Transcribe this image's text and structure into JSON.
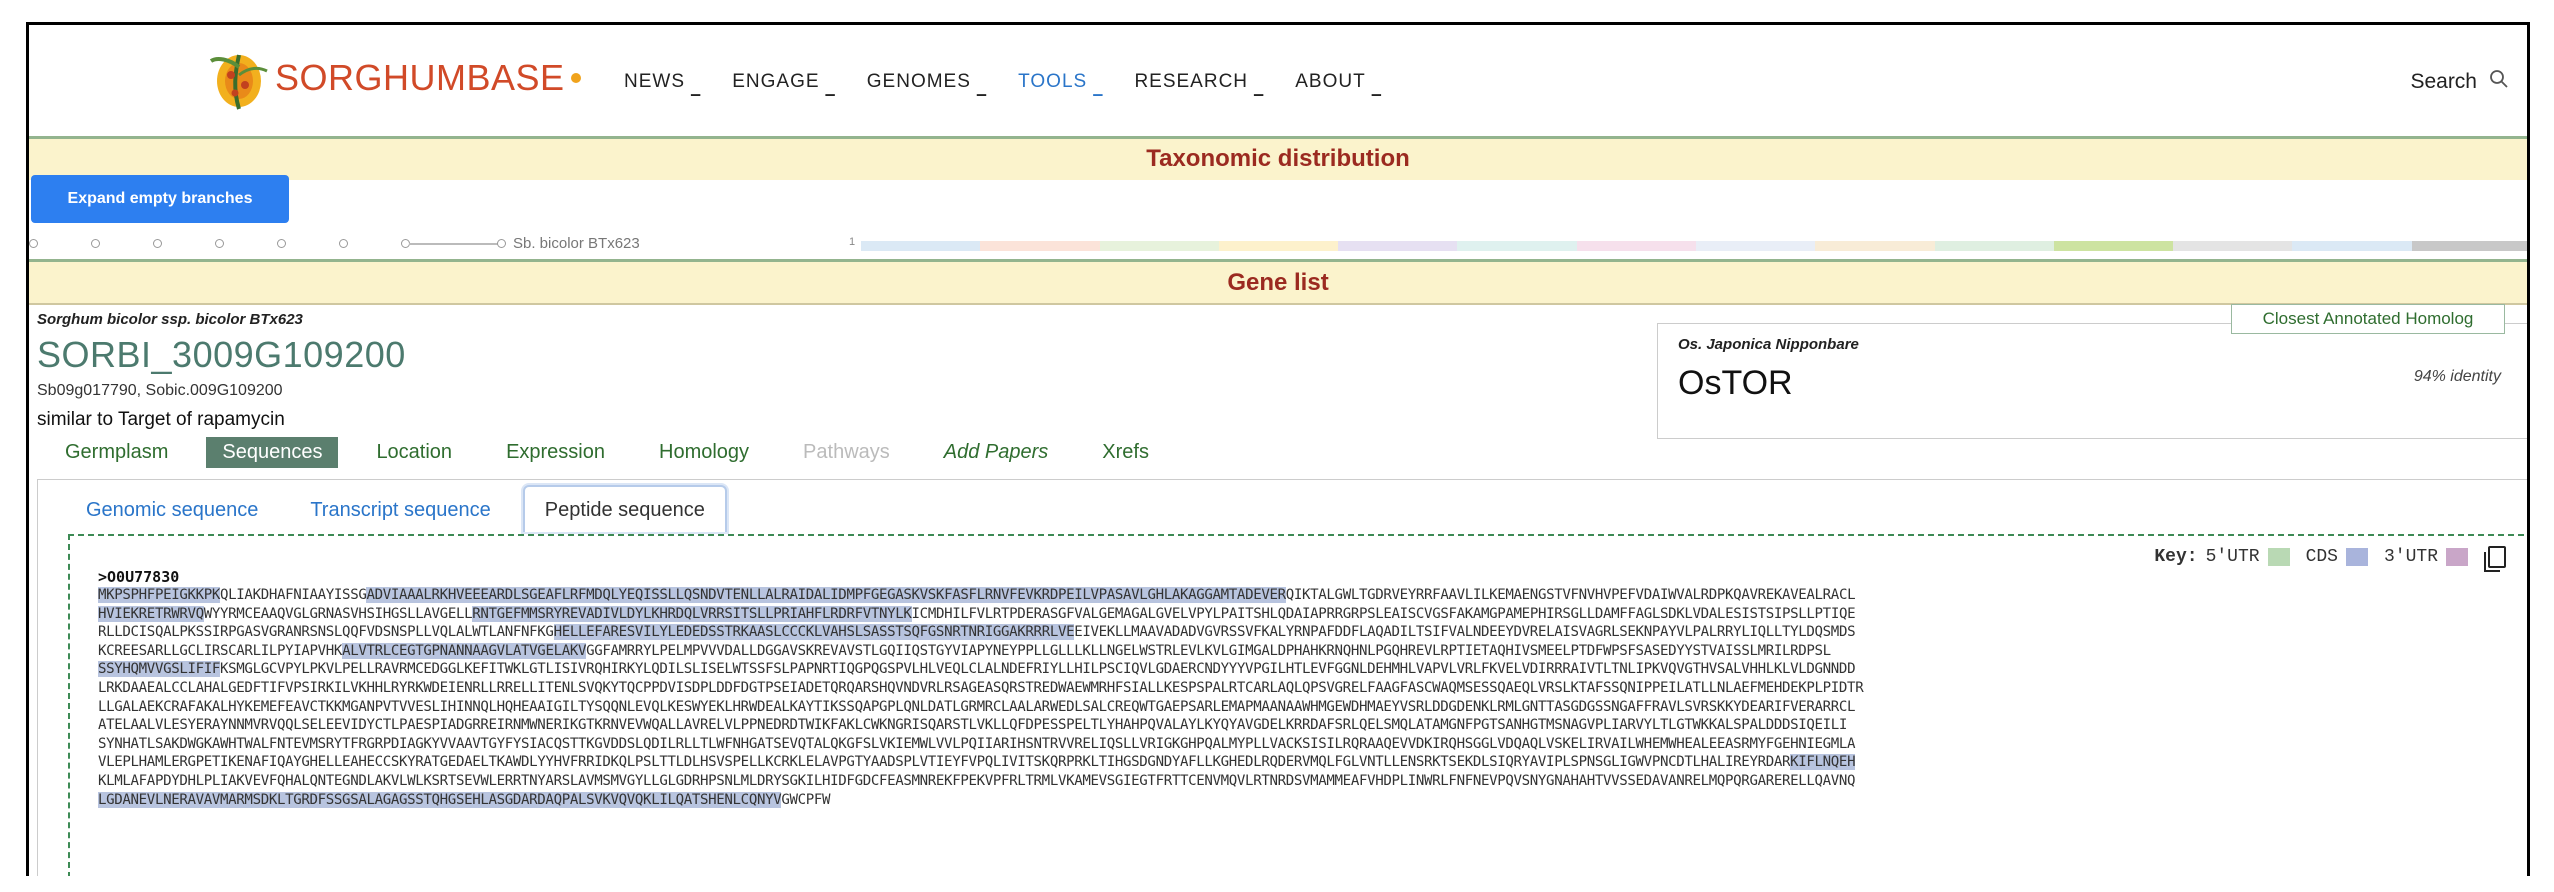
{
  "header": {
    "logo_text": "SORGHUMBASE",
    "nav": [
      {
        "label": "NEWS",
        "active": false
      },
      {
        "label": "ENGAGE",
        "active": false
      },
      {
        "label": "GENOMES",
        "active": false
      },
      {
        "label": "TOOLS",
        "active": true
      },
      {
        "label": "RESEARCH",
        "active": false
      },
      {
        "label": "ABOUT",
        "active": false
      }
    ],
    "search_label": "Search"
  },
  "taxonomy": {
    "title": "Taxonomic distribution",
    "expand_label": "Expand empty branches",
    "species_label": "Sb. bicolor BTx623",
    "count_label": "1"
  },
  "gene_list": {
    "title": "Gene list",
    "species": "Sorghum bicolor ssp. bicolor BTx623",
    "gene_id": "SORBI_3009G109200",
    "synonyms": "Sb09g017790, Sobic.009G109200",
    "description": "similar to Target of rapamycin",
    "tabs": [
      {
        "label": "Germplasm",
        "state": "normal"
      },
      {
        "label": "Sequences",
        "state": "active"
      },
      {
        "label": "Location",
        "state": "normal"
      },
      {
        "label": "Expression",
        "state": "normal"
      },
      {
        "label": "Homology",
        "state": "normal"
      },
      {
        "label": "Pathways",
        "state": "disabled"
      },
      {
        "label": "Add Papers",
        "state": "italic"
      },
      {
        "label": "Xrefs",
        "state": "normal"
      }
    ],
    "homolog": {
      "button_label": "Closest Annotated Homolog",
      "species": "Os. Japonica Nipponbare",
      "gene": "OsTOR",
      "identity": "94% identity"
    }
  },
  "sequence": {
    "tabs": [
      {
        "label": "Genomic sequence",
        "active": false
      },
      {
        "label": "Transcript sequence",
        "active": false
      },
      {
        "label": "Peptide sequence",
        "active": true
      }
    ],
    "key": {
      "label": "Key:",
      "items": [
        {
          "label": "5'UTR",
          "color": "#b9d9b4"
        },
        {
          "label": "CDS",
          "color": "#a9b4dc"
        },
        {
          "label": "3'UTR",
          "color": "#c9a6c8"
        }
      ]
    },
    "header": ">O0U77830",
    "lines": [
      [
        [
          "MKPSPHFPEIGKKPK",
          1
        ],
        [
          "QLIAKDHAFNIAAYISSG",
          0
        ],
        [
          "ADVIAAALRKHVEEEARDLSGEAFLRFMDQLYEQISSLLQSNDVTENLLALRAIDALIDMPFGEGASKVSKFASFLRNVFEVKRDPEILVPASAVLGHLAKAGGAMTADEVER",
          1
        ],
        [
          "QIKTALGWLTGDRVEYRRFAAVLILKEMAENGSTVFNVHVPEFVDAIWVALRDPKQAVREKAVEALRACL",
          0
        ]
      ],
      [
        [
          "HVIEKRETRWRVQ",
          1
        ],
        [
          "WYYRMCEAAQVGLGRNASVHSIHGSLLAVGELL",
          0
        ],
        [
          "RNTGEFMMSRYREVADIVLDYLKHRDQLVRRSITSLLPRIAHFLRDRFVTNYLK",
          1
        ],
        [
          "ICMDHILFVLRTPDERASGFVALGEMAGALGVELVPYLPAITSHLQDAIAPRRGRPSLEAISCVGSFAKAMGPAMEPHIRSGLLDAMFFAGLSDKLVDALESISTSIPSLLPTIQE",
          0
        ]
      ],
      [
        [
          "RLLDCISQALPKSSIRPGASVGRANRSNSLQQFVDSNSPLLVQLALWTLANFNFKG",
          0
        ],
        [
          "HELLEFARESVILYLEDEDSSTRKAASLCCCKLVAHSLSASSTSQFGSNRTNRIGGAKRRRLVE",
          1
        ],
        [
          "EIVEKLLMAAVADADVGVRSSVFKALYRNPAFDDFLAQADILTSIFVALNDEEYDVRELAISVAGRLSEKNPAYVLPALRRYLIQLLTYLDQSMDS",
          0
        ]
      ],
      [
        [
          "KCREESARLLGCLIRSCARLILPYIAPVHK",
          0
        ],
        [
          "ALVTRLCEGTGPNANNAAGVLATVGELAKV",
          1
        ],
        [
          "GGFAMRRYLPELMPVVVDALLDGGAVSKREVAVSTLGQIIQSTGYVIAPYNEYPPLLGLLLKLLNGELWSTRLEVLKVLGIMGALDPHAHKRNQHNLPGQHREVLRPTIETAQHIVSMEELPTDFWPSFSASEDYYSTVAISSLMRILRDPSL",
          0
        ]
      ],
      [
        [
          "SSYHQMVVGSLIFIF",
          1
        ],
        [
          "KSMGLGCVPYLPKVLPELLRAVRMCEDGGLKEFITWKLGTLISIVRQHIRKYLQDILSLISELWTSSFSLPAPNRTIQGPQGSPVLHLVEQLCLALNDEFRIYLLHILPSCIQVLGDAERCNDYYYVPGILHTLEVFGGNLDEHMHLVAPVLVRLFKVELVDIRRRAIVTLTNLIPKVQVGTHVSALVHHLKLVLDGNNDD",
          0
        ]
      ],
      [
        [
          "LRKDAAEALCCLAHALGEDFTIFVPSIRKILVKHHLRYRKWDEIENRLLRRELLITENLSVQKYTQCPPDVISDPLDDFDGTPSEIADETQRQARSHQVNDVRLRSAGEASQRSTREDWAEWMRHFSIALLKESPSPALRTCARLAQLQPSVGRELFAAGFASCWAQMSESSQAEQLVRSLKTAFSSQNIPPEILATLLNLAEFMEHDEKPLPIDTR",
          0
        ]
      ],
      [
        [
          "LLGALAEKCRAFAKALHYKEMEFEAVCTKKMGANPVTVVESLIHINNQLHQHEAAIGILTYSQQNLEVQLKESWYEKLHRWDEALKAYTIKSSQAPGPLQNLDATLGRMRCLAALARWEDLSALCREQWTGAEPSARLEMAPMAANAAWHMGEWDHMAEYVSRLDDGDENKLRMLGNTTASGDGSSNGAFFRAVLSVRSKKYDEARIFVERARRCL",
          0
        ]
      ],
      [
        [
          "ATELAALVLESYERAYNNMVRVQQLSELEEVIDYCTLPAESPIADGRREIRNMWNERIKGTKRNVEVWQALLAVRELVLPPNEDRDTWIKFAKLCWKNGRISQARSTLVKLLQFDPESSPELTLYHAHPQVALAYLKYQYAVGDELKRRDAFSRLQELSMQLATAMGNFPGTSANHGTMSNAGVPLIARVYLTLGTWKKALSPALDDDSIQEILI",
          0
        ]
      ],
      [
        [
          "SYNHATLSAKDWGKAWHTWALFNTEVMSRYTFRGRPDIAGKYVVAAVTGYFYSIACQSTTKGVDDSLQDILRLLTLWFNHGATSEVQTALQKGFSLVKIEMWLVVLPQIIARIHSNTRVVRELIQSLLVRIGKGHPQALMYPLLVACKSISILRQRAAQEVVDKIRQHSGGLVDQAQLVSKELIRVAILWHEMWHEALEEASRMYFGEHNIEGMLA",
          0
        ]
      ],
      [
        [
          "VLEPLHAMLERGPETIKENAFIQAYGHELLEAHECCSKYRATGEDAELTKAWDLYYHVFRRIDKQLPSLTTLDLHSVSPELLKCRKLELAVPGTYAADSPLVTIEYFVPQLIVITSKQRPRKLTIHGSDGNDYAFLLKGHEDLRQDERVMQLFGLVNTLLENSRKTSEKDLSIQRYAVIPLSPNSGLIGWVPNCDTLHALIREYRDAR",
          0
        ],
        [
          "KIFLNQEH",
          1
        ]
      ],
      [
        [
          "KLMLAFAPDYDHLPLIAKVEVFQHALQNTEGNDLAKVLWLKSRTSEVWLERRTNYARSLAVMSMVGYLLGLGDRHPSNLMLDRYSGKILHIDFGDCFEASMNREKFPEKVPFRLTRMLVKAMEVSGIEGTFRTTCENVMQVLRTNRDSVMAMMEAFVHDPLINWRLFNFNEVPQVSNYGNAHAHTVVSSEDAVANRELMQPQRGARERELLQAVNQ",
          0
        ]
      ],
      [
        [
          "LGDANEVLNERAVAVMARMSDKLTGRDFSSGSALAGAGSSTQHGSEHLASGDARDAQPALSVKVQVQKLILQATSHENLCQNYV",
          1
        ],
        [
          "GWCPFW",
          0
        ]
      ]
    ]
  }
}
